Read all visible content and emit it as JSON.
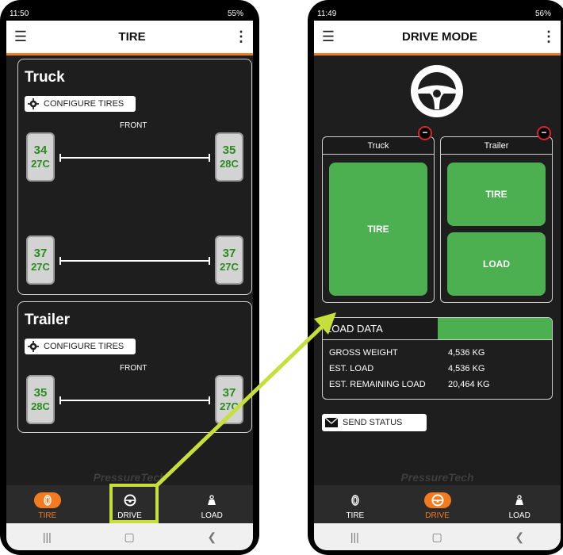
{
  "left_phone": {
    "status": {
      "time": "11:50",
      "battery": "55%"
    },
    "appbar": {
      "title": "TIRE"
    },
    "truck": {
      "title": "Truck",
      "configure_label": "CONFIGURE TIRES",
      "front_label": "FRONT",
      "axles": [
        {
          "left": {
            "pressure": "34",
            "temp": "27C"
          },
          "right": {
            "pressure": "35",
            "temp": "28C"
          }
        },
        {
          "left": {
            "pressure": "37",
            "temp": "27C"
          },
          "right": {
            "pressure": "37",
            "temp": "27C"
          }
        }
      ]
    },
    "trailer": {
      "title": "Trailer",
      "configure_label": "CONFIGURE TIRES",
      "front_label": "FRONT",
      "axles": [
        {
          "left": {
            "pressure": "35",
            "temp": "28C"
          },
          "right": {
            "pressure": "37",
            "temp": "27C"
          }
        }
      ]
    },
    "brand": "PressureTech",
    "nav": [
      {
        "label": "TIRE",
        "icon": "tire-icon",
        "active": true
      },
      {
        "label": "DRIVE",
        "icon": "steering-wheel-icon",
        "active": false
      },
      {
        "label": "LOAD",
        "icon": "weight-icon",
        "active": false
      }
    ]
  },
  "right_phone": {
    "status": {
      "time": "11:49",
      "battery": "56%"
    },
    "appbar": {
      "title": "DRIVE MODE"
    },
    "truck_box": {
      "header": "Truck",
      "button": "TIRE"
    },
    "trailer_box": {
      "header": "Trailer",
      "tire_button": "TIRE",
      "load_button": "LOAD"
    },
    "load_data": {
      "title": "LOAD DATA",
      "rows": [
        {
          "label": "GROSS WEIGHT",
          "value": "4,536 KG"
        },
        {
          "label": "EST. LOAD",
          "value": "4,536 KG"
        },
        {
          "label": "EST. REMAINING LOAD",
          "value": "20,464 KG"
        }
      ]
    },
    "send_status": "SEND STATUS",
    "brand": "PressureTech",
    "nav": [
      {
        "label": "TIRE",
        "icon": "tire-icon",
        "active": false
      },
      {
        "label": "DRIVE",
        "icon": "steering-wheel-icon",
        "active": true
      },
      {
        "label": "LOAD",
        "icon": "weight-icon",
        "active": false
      }
    ]
  },
  "colors": {
    "accent": "#f47a20",
    "green": "#4caf50",
    "highlight": "#c7df3a",
    "tire_text": "#2a8c1f"
  }
}
